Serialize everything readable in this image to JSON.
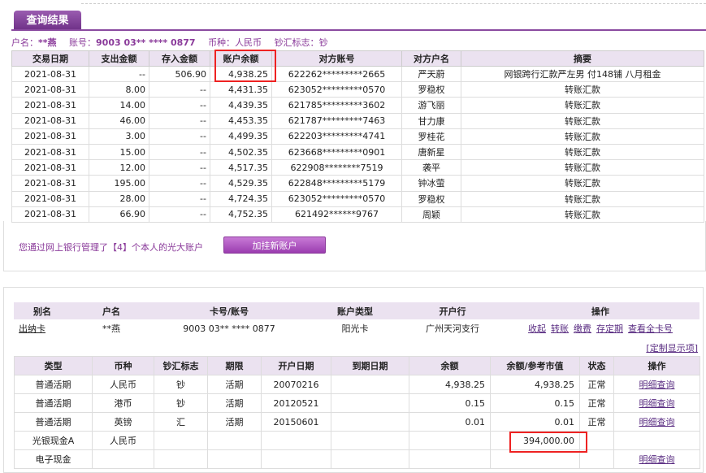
{
  "tab_title": "查询结果",
  "info": {
    "name_label": "户名：",
    "name_value": "**燕",
    "account_label": "账号：",
    "account_value": "9003 03** **** 0877",
    "currency_label": "币种：",
    "currency_value": "人民币",
    "flag_label": "钞汇标志：",
    "flag_value": "钞"
  },
  "tx_headers": [
    "交易日期",
    "支出金额",
    "存入金额",
    "账户余额",
    "对方账号",
    "对方户名",
    "摘要"
  ],
  "tx_rows": [
    [
      "2021-08-31",
      "--",
      "506.90",
      "4,938.25",
      "622262*********2665",
      "严天蔚",
      "网银跨行汇款严左男 付148铺 八月租金"
    ],
    [
      "2021-08-31",
      "8.00",
      "--",
      "4,431.35",
      "623052*********0570",
      "罗稳权",
      "转账汇款"
    ],
    [
      "2021-08-31",
      "14.00",
      "--",
      "4,439.35",
      "621785*********3602",
      "游飞丽",
      "转账汇款"
    ],
    [
      "2021-08-31",
      "46.00",
      "--",
      "4,453.35",
      "621787*********7463",
      "甘力康",
      "转账汇款"
    ],
    [
      "2021-08-31",
      "3.00",
      "--",
      "4,499.35",
      "622203*********4741",
      "罗桂花",
      "转账汇款"
    ],
    [
      "2021-08-31",
      "15.00",
      "--",
      "4,502.35",
      "623668*********0901",
      "唐新星",
      "转账汇款"
    ],
    [
      "2021-08-31",
      "12.00",
      "--",
      "4,517.35",
      "622908********7519",
      "袭平",
      "转账汇款"
    ],
    [
      "2021-08-31",
      "195.00",
      "--",
      "4,529.35",
      "622848*********5179",
      "钟冰萤",
      "转账汇款"
    ],
    [
      "2021-08-31",
      "28.00",
      "--",
      "4,724.35",
      "623052*********0570",
      "罗稳权",
      "转账汇款"
    ],
    [
      "2021-08-31",
      "66.90",
      "--",
      "4,752.35",
      "621492******9767",
      "周颖",
      "转账汇款"
    ]
  ],
  "mid_text": "您通过网上银行管理了【4】个本人的光大账户",
  "add_account_button": "加挂新账户",
  "acct_headers": [
    "别名",
    "户名",
    "卡号/账号",
    "账户类型",
    "开户行",
    "操作"
  ],
  "acct_row": {
    "alias": "出纳卡",
    "name": "**燕",
    "card": "9003 03** **** 0877",
    "type": "阳光卡",
    "branch": "广州天河支行",
    "ops": [
      "收起",
      "转账",
      "缴费",
      "存定期",
      "查看全卡号"
    ]
  },
  "custom_display": "[定制显示项]",
  "det_headers": [
    "类型",
    "币种",
    "钞汇标志",
    "期限",
    "开户日期",
    "到期日期",
    "余额",
    "余额/参考市值",
    "状态",
    "操作"
  ],
  "det_rows": [
    [
      "普通活期",
      "人民币",
      "钞",
      "活期",
      "20070216",
      "",
      "4,938.25",
      "4,938.25",
      "正常",
      "明细查询"
    ],
    [
      "普通活期",
      "港币",
      "钞",
      "活期",
      "20120521",
      "",
      "0.15",
      "0.15",
      "正常",
      "明细查询"
    ],
    [
      "普通活期",
      "英镑",
      "汇",
      "活期",
      "20150601",
      "",
      "0.01",
      "0.01",
      "正常",
      "明细查询"
    ],
    [
      "光银现金A",
      "人民币",
      "",
      "",
      "",
      "",
      "",
      "394,000.00",
      "",
      ""
    ],
    [
      "电子现金",
      "",
      "",
      "",
      "",
      "",
      "",
      "",
      "",
      "明细查询"
    ]
  ],
  "colors": {
    "accent": "#8a3a9a",
    "header_bg": "#ebe2f0",
    "highlight_box": "#e22222",
    "link": "#5a2d82"
  }
}
